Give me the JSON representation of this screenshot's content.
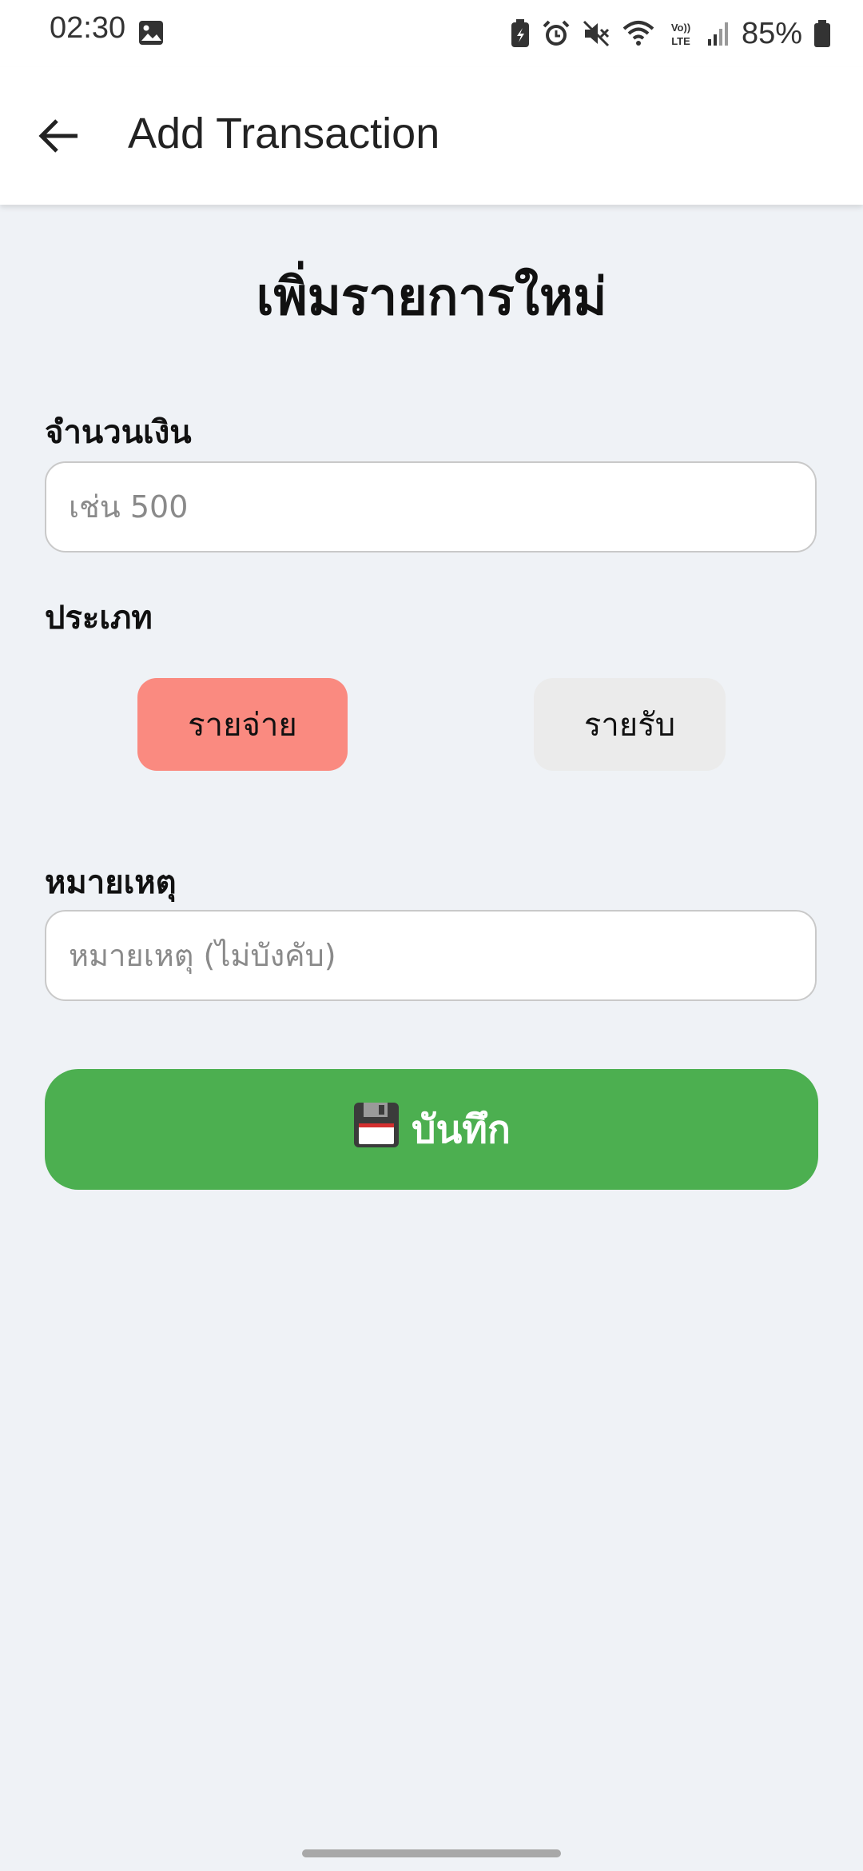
{
  "status_bar": {
    "time": "02:30",
    "battery": "85%",
    "icons": [
      "gallery-icon",
      "battery-saver-icon",
      "alarm-icon",
      "mute-icon",
      "wifi-icon",
      "volte-icon",
      "signal-icon",
      "battery-icon"
    ]
  },
  "app_bar": {
    "title": "Add Transaction",
    "back_icon": "back-arrow-icon"
  },
  "form": {
    "heading": "เพิ่มรายการใหม่",
    "amount": {
      "label": "จำนวนเงิน",
      "placeholder": "เช่น 500",
      "value": ""
    },
    "type": {
      "label": "ประเภท",
      "options": [
        {
          "label": "รายจ่าย",
          "selected": true,
          "color": "#fa8a80"
        },
        {
          "label": "รายรับ",
          "selected": false,
          "color": "#ebebeb"
        }
      ]
    },
    "note": {
      "label": "หมายเหตุ",
      "placeholder": "หมายเหตุ (ไม่บังคับ)",
      "value": ""
    },
    "save": {
      "label": "บันทึก",
      "icon": "floppy-disk-icon",
      "color": "#4caf50"
    }
  },
  "colors": {
    "background": "#eff2f6",
    "app_bar": "#ffffff"
  }
}
